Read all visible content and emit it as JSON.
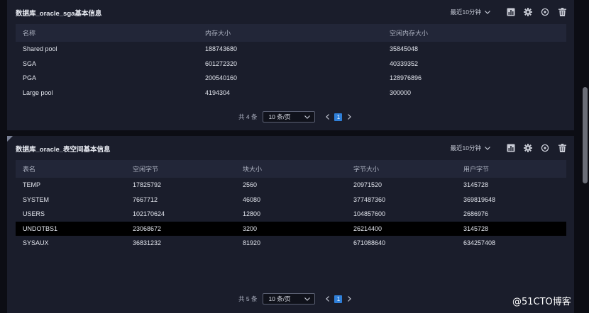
{
  "panels": [
    {
      "title": "数据库_oracle_sga基本信息",
      "time_range": "最近10分钟",
      "columns": [
        "名称",
        "内存大小",
        "空闲内存大小"
      ],
      "rows": [
        [
          "Shared pool",
          "188743680",
          "35845048"
        ],
        [
          "SGA",
          "601272320",
          "40339352"
        ],
        [
          "PGA",
          "200540160",
          "128976896"
        ],
        [
          "Large pool",
          "4194304",
          "300000"
        ]
      ],
      "pager": {
        "total": "共 4 条",
        "page_size": "10 条/页",
        "current_page": "1"
      }
    },
    {
      "title": "数据库_oracle_表空间基本信息",
      "time_range": "最近10分钟",
      "columns": [
        "表名",
        "空闲字节",
        "块大小",
        "字节大小",
        "用户字节"
      ],
      "rows": [
        [
          "TEMP",
          "17825792",
          "2560",
          "20971520",
          "3145728"
        ],
        [
          "SYSTEM",
          "7667712",
          "46080",
          "377487360",
          "369819648"
        ],
        [
          "USERS",
          "102170624",
          "12800",
          "104857600",
          "2686976"
        ],
        [
          "UNDOTBS1",
          "23068672",
          "3200",
          "26214400",
          "3145728"
        ],
        [
          "SYSAUX",
          "36831232",
          "81920",
          "671088640",
          "634257408"
        ]
      ],
      "selected_row": 3,
      "pager": {
        "total": "共 5 条",
        "page_size": "10 条/页",
        "current_page": "1"
      }
    }
  ],
  "toolbar_icons": [
    "bar-chart-icon",
    "gear-icon",
    "refresh-icon",
    "trash-icon"
  ],
  "watermark": "@51CTO博客",
  "colors": {
    "background": "#0c0d14",
    "panel": "#1a1d2b",
    "table_header": "#222638",
    "selected_row": "#000000",
    "accent": "#2f7fd8"
  }
}
